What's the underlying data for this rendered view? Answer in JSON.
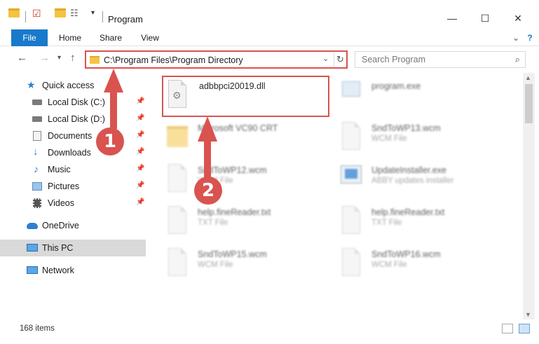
{
  "window": {
    "title": "Program",
    "minimize": "—",
    "maximize": "☐",
    "close": "✕"
  },
  "ribbon": {
    "tabs": [
      "File",
      "Home",
      "Share",
      "View"
    ],
    "expand": "⌄",
    "help": "?"
  },
  "address": {
    "path": "C:\\Program Files\\Program Directory",
    "refresh": "↻",
    "dropdown": "⌄"
  },
  "search": {
    "placeholder": "Search Program"
  },
  "sidebar": {
    "items": [
      {
        "label": "Quick access",
        "icon": "star-icon",
        "color": "#2f7fd1"
      },
      {
        "label": "Local Disk (C:)",
        "icon": "drive-icon",
        "color": "#6a6a6a"
      },
      {
        "label": "Local Disk (D:)",
        "icon": "drive-icon",
        "color": "#6a6a6a"
      },
      {
        "label": "Documents",
        "icon": "documents-icon",
        "color": "#8a8a8a"
      },
      {
        "label": "Downloads",
        "icon": "download-icon",
        "color": "#2f7fd1"
      },
      {
        "label": "Music",
        "icon": "music-icon",
        "color": "#2f7fd1"
      },
      {
        "label": "Pictures",
        "icon": "pictures-icon",
        "color": "#6aa0d6"
      },
      {
        "label": "Videos",
        "icon": "videos-icon",
        "color": "#5a5a5a"
      },
      {
        "label": "OneDrive",
        "icon": "cloud-icon",
        "color": "#2f7fd1"
      },
      {
        "label": "This PC",
        "icon": "computer-icon",
        "color": "#3a8fd9"
      },
      {
        "label": "Network",
        "icon": "network-icon",
        "color": "#3a8fd9"
      }
    ]
  },
  "files": [
    {
      "name": "adbbpci20019.dll",
      "type": ""
    },
    {
      "name": "program.exe",
      "type": ""
    },
    {
      "name": "Microsoft VC90 CRT",
      "type": ""
    },
    {
      "name": "SndToWP13.wcm",
      "type": "WCM File"
    },
    {
      "name": "SndToWP12.wcm",
      "type": "WCM File"
    },
    {
      "name": "UpdateInstaller.exe",
      "type": "ABBY updates installer"
    },
    {
      "name": "help.fineReader.txt",
      "type": "TXT File"
    },
    {
      "name": "help.fineReader.txt",
      "type": "TXT File"
    },
    {
      "name": "SndToWP15.wcm",
      "type": "WCM File"
    },
    {
      "name": "SndToWP16.wcm",
      "type": "WCM File"
    }
  ],
  "annotations": {
    "step1": "1",
    "step2": "2",
    "color": "#d9534f"
  },
  "status": {
    "item_count": "168 items"
  }
}
